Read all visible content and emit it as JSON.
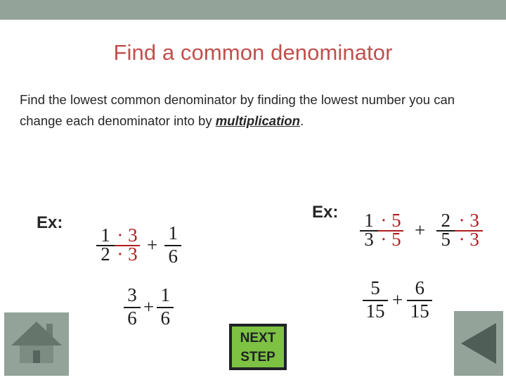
{
  "theme": {
    "band_color": "#93a399",
    "title_color": "#c0504d",
    "accent_red": "#b01d20",
    "button_green": "#7dc242",
    "button_border": "#1f2224",
    "text_color": "#262626"
  },
  "slide": {
    "title": "Find a common denominator",
    "body": {
      "before": "Find the lowest common denominator by finding the lowest number you can change each denominator into by ",
      "emphasis": "multiplication",
      "after": "."
    }
  },
  "examples": {
    "left": {
      "label": "Ex:",
      "step1": {
        "fraction1": {
          "numerator_main": "1",
          "numerator_mult": "· 3",
          "denominator_main": "2",
          "denominator_mult": "· 3"
        },
        "operator": "+",
        "fraction2": {
          "numerator": "1",
          "denominator": "6"
        }
      },
      "step2": {
        "fraction1": {
          "numerator": "3",
          "denominator": "6"
        },
        "operator": "+",
        "fraction2": {
          "numerator": "1",
          "denominator": "6"
        }
      }
    },
    "right": {
      "label": "Ex:",
      "step1": {
        "fraction1": {
          "numerator_main": "1",
          "numerator_mult": "· 5",
          "denominator_main": "3",
          "denominator_mult": "· 5"
        },
        "operator": "+",
        "fraction2": {
          "numerator_main": "2",
          "numerator_mult": "· 3",
          "denominator_main": "5",
          "denominator_mult": "· 3"
        }
      },
      "step2": {
        "fraction1": {
          "numerator": "5",
          "denominator": "15"
        },
        "operator": "+",
        "fraction2": {
          "numerator": "6",
          "denominator": "15"
        }
      }
    }
  },
  "navigation": {
    "home_icon": "home-icon",
    "back_icon": "triangle-left-icon",
    "next_step": {
      "line1": "NEXT",
      "line2": "STEP"
    }
  }
}
